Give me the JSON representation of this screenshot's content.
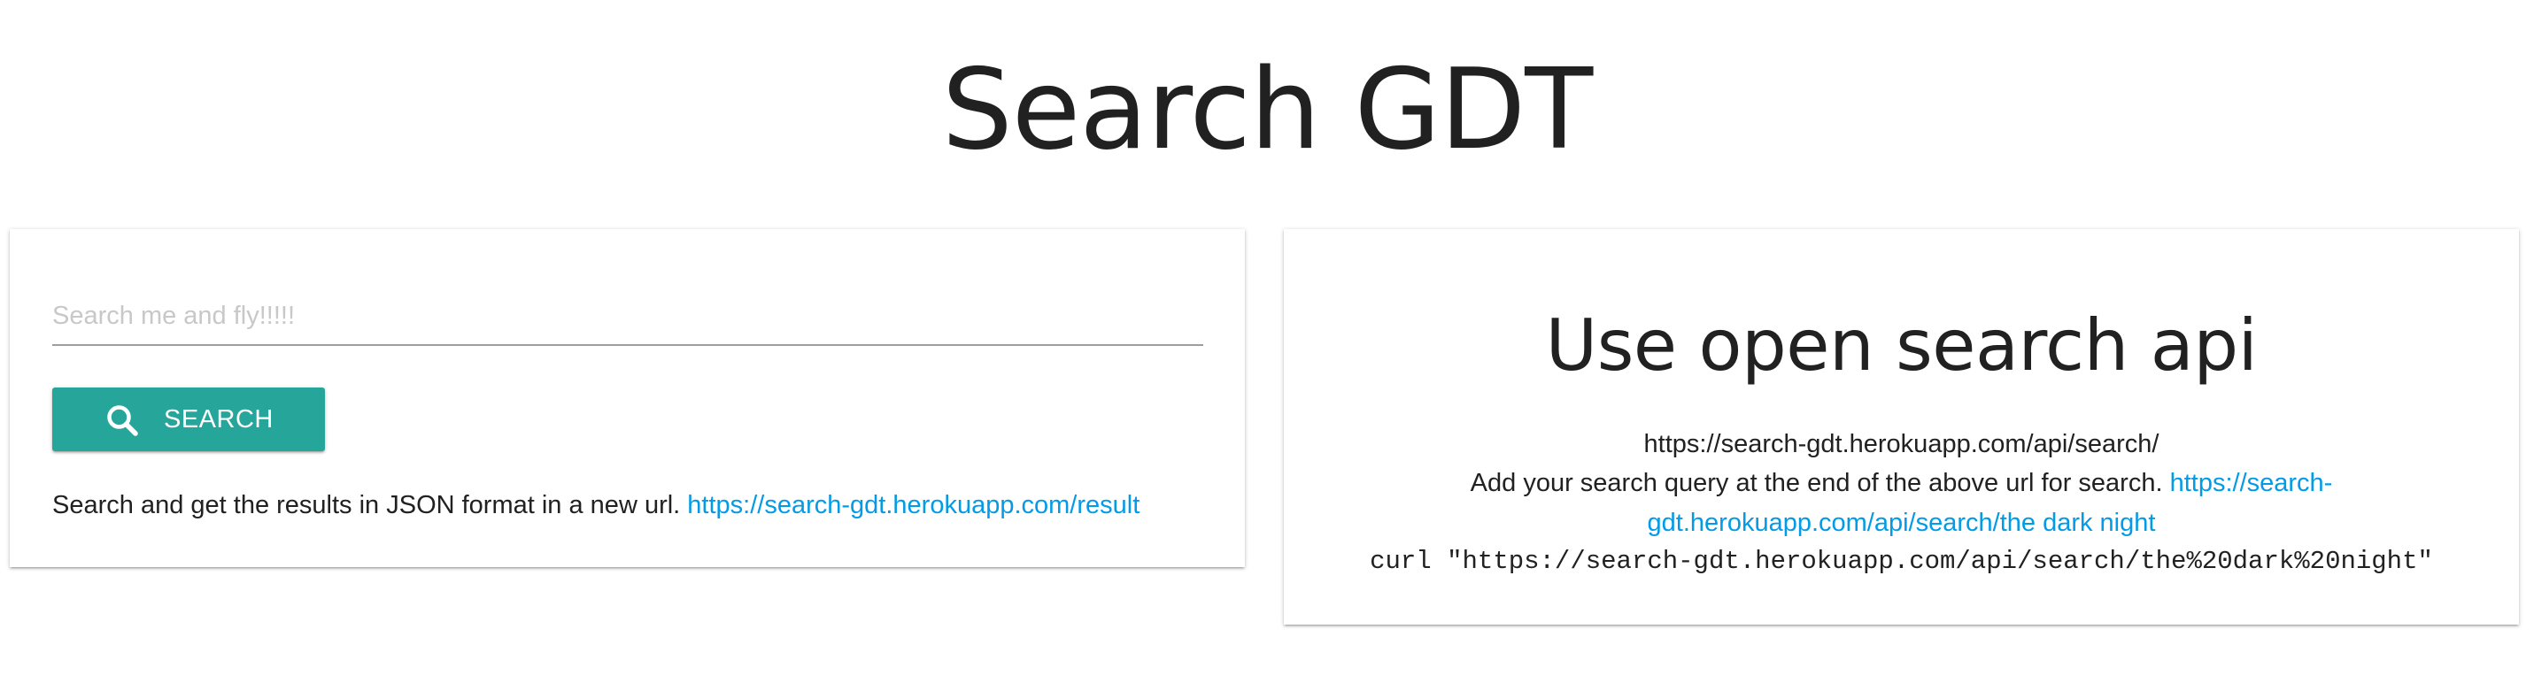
{
  "header": {
    "title": "Search GDT"
  },
  "search_card": {
    "input": {
      "placeholder": "Search me and fly!!!!!",
      "value": ""
    },
    "button": {
      "icon": "search-icon",
      "label": "SEARCH"
    },
    "description": "Search and get the results in JSON format in a new url.",
    "result_link": "https://search-gdt.herokuapp.com/result"
  },
  "api_card": {
    "title": "Use open search api",
    "endpoint": "https://search-gdt.herokuapp.com/api/search/",
    "description": "Add your search query at the end of the above url for search.",
    "example_link": "https://search-gdt.herokuapp.com/api/search/the dark night",
    "curl_example": "curl \"https://search-gdt.herokuapp.com/api/search/the%20dark%20night\""
  },
  "colors": {
    "accent": "#26a69a",
    "link": "#039be5",
    "text": "#212121",
    "placeholder": "#c8c8c8"
  }
}
